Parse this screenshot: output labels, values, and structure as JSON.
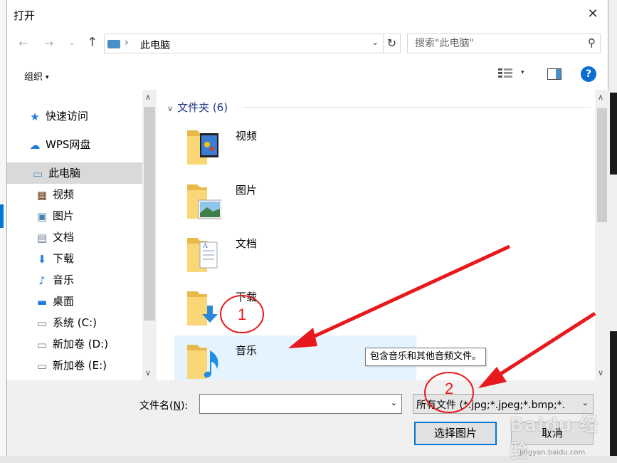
{
  "window": {
    "title": "打开",
    "close_glyph": "✕"
  },
  "nav": {
    "back": "←",
    "forward": "→",
    "recent": "⌄",
    "up": "↑",
    "address_sep": "›",
    "address_path": "此电脑",
    "address_dropdown": "⌄",
    "refresh": "↻",
    "search_placeholder": "搜索\"此电脑\"",
    "search_icon": "⚲"
  },
  "toolbar": {
    "organize_label": "组织",
    "organize_arrow": "▾",
    "view_dd": "▾",
    "help": "?"
  },
  "sidebar": {
    "items": [
      {
        "label": "快速访问",
        "icon": "star-icon",
        "glyph": "★",
        "color": "#1e7dd8"
      },
      {
        "label": "WPS网盘",
        "icon": "cloud-icon",
        "glyph": "☁",
        "color": "#1e7dd8"
      },
      {
        "label": "此电脑",
        "icon": "computer-icon",
        "glyph": "▭",
        "color": "#4a90c8",
        "selected": true
      },
      {
        "label": "视频",
        "icon": "video-icon",
        "glyph": "▦",
        "color": "#6b3e1e"
      },
      {
        "label": "图片",
        "icon": "picture-icon",
        "glyph": "▣",
        "color": "#4a7fa8"
      },
      {
        "label": "文档",
        "icon": "document-icon",
        "glyph": "▤",
        "color": "#6b7d95"
      },
      {
        "label": "下载",
        "icon": "download-icon",
        "glyph": "⬇",
        "color": "#1e7dd8"
      },
      {
        "label": "音乐",
        "icon": "music-icon",
        "glyph": "♪",
        "color": "#1e7dd8"
      },
      {
        "label": "桌面",
        "icon": "desktop-icon",
        "glyph": "▬",
        "color": "#1e7dd8"
      },
      {
        "label": "系统 (C:)",
        "icon": "drive-c-icon",
        "glyph": "▭",
        "color": "#777777"
      },
      {
        "label": "新加卷 (D:)",
        "icon": "drive-d-icon",
        "glyph": "▭",
        "color": "#777777"
      },
      {
        "label": "新加卷 (E:)",
        "icon": "drive-e-icon",
        "glyph": "▭",
        "color": "#777777"
      }
    ],
    "scroll_up": "∧",
    "scroll_down": "∨"
  },
  "main": {
    "group_chevron": "∨",
    "group_header": "文件夹 (6)",
    "folders": [
      {
        "name": "视频",
        "overlay": "video"
      },
      {
        "name": "图片",
        "overlay": "picture"
      },
      {
        "name": "文档",
        "overlay": "document"
      },
      {
        "name": "下载",
        "overlay": "download"
      },
      {
        "name": "音乐",
        "overlay": "music",
        "hovered": true
      }
    ],
    "tooltip": "包含音乐和其他音频文件。",
    "scroll_up": "∧",
    "scroll_down": "∨"
  },
  "footer": {
    "filename_label": "文件名(",
    "filename_hotkey": "N",
    "filename_label_end": "):",
    "filename_value": "",
    "filetype_value": "所有文件 (*.jpg;*.jpeg;*.bmp;*.",
    "dropdown_glyph": "⌄",
    "open_button": "选择图片",
    "cancel_button": "取消"
  },
  "annotations": {
    "callout_1": "1",
    "callout_2": "2",
    "arrow_color": "#e8191c"
  },
  "watermark": {
    "brand": "Baidu 经验",
    "url": "jingyan.baidu.com"
  }
}
